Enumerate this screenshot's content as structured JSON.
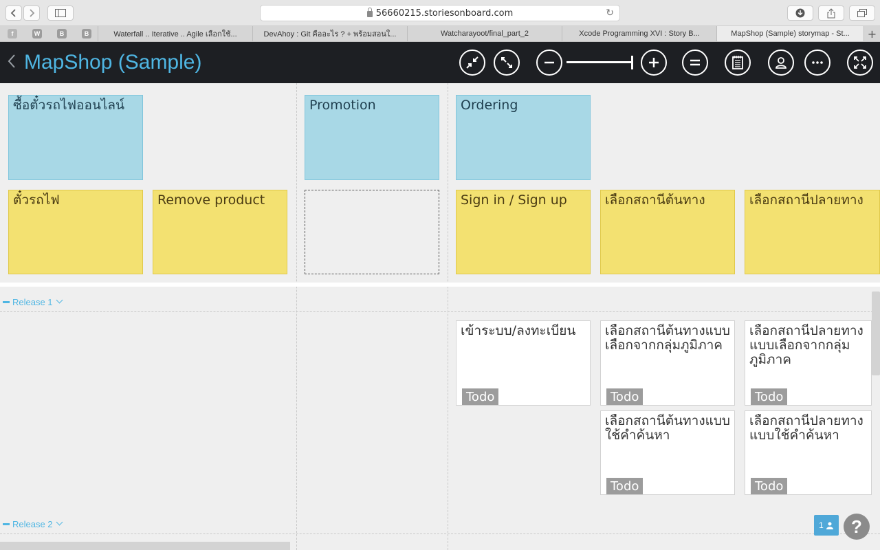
{
  "browser": {
    "url": "56660215.storiesonboard.com",
    "favorites": [
      {
        "icon": "facebook-icon",
        "letter": "f"
      },
      {
        "icon": "w-icon",
        "letter": "W"
      },
      {
        "icon": "b-icon",
        "letter": "B"
      },
      {
        "icon": "b-icon",
        "letter": "B"
      }
    ],
    "tabs": [
      {
        "label": "Waterfall .. Iterative .. Agile เลือกใช้..."
      },
      {
        "label": "DevAhoy : Git คืออะไร ? + พร้อมสอนใ..."
      },
      {
        "label": "Watcharayoot/final_part_2"
      },
      {
        "label": "Xcode Programming XVI : Story B..."
      },
      {
        "label": "MapShop (Sample) storymap - St..."
      }
    ]
  },
  "app": {
    "title": "MapShop (Sample)",
    "zoom_level": 1.0
  },
  "map": {
    "activities": [
      {
        "label": "ซื้อตั๋วรถไฟออนไลน์"
      },
      {
        "label": "Promotion"
      },
      {
        "label": "Ordering"
      }
    ],
    "tasks": [
      {
        "label": "ตั๋วรถไฟ"
      },
      {
        "label": "Remove product"
      },
      {
        "label": ""
      },
      {
        "label": "Sign in / Sign up"
      },
      {
        "label": "เลือกสถานีต้นทาง"
      },
      {
        "label": "เลือกสถานีปลายทาง"
      }
    ],
    "releases": [
      {
        "label": "Release 1",
        "stories": [
          {
            "label": "เข้าระบบ/ลงทะเบียน",
            "status": "Todo"
          },
          {
            "label": "เลือกสถานีต้นทางแบบเลือกจากกลุ่มภูมิภาค",
            "status": "Todo"
          },
          {
            "label": "เลือกสถานีปลายทางแบบเลือกจากกลุ่มภูมิภาค",
            "status": "Todo"
          },
          {
            "label": "เลือกสถานีต้นทางแบบใช้คำค้นหา",
            "status": "Todo"
          },
          {
            "label": "เลือกสถานีปลายทางแบบใช้คำค้นหา",
            "status": "Todo"
          }
        ]
      },
      {
        "label": "Release 2",
        "stories": []
      }
    ]
  },
  "footer": {
    "online_users": "1",
    "help": "?"
  }
}
